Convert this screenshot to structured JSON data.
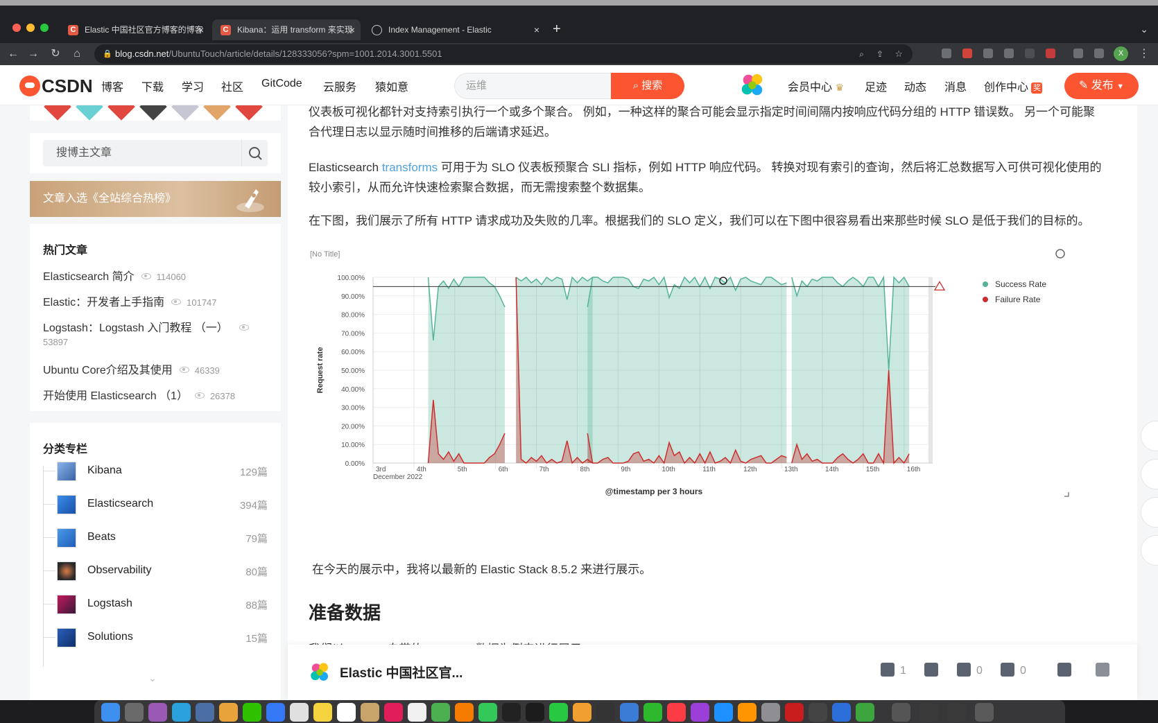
{
  "browser": {
    "tabs": [
      {
        "title": "Elastic 中国社区官方博客的博客",
        "active": false
      },
      {
        "title": "Kibana：运用 transform 来实现",
        "active": true
      },
      {
        "title": "Index Management - Elastic",
        "active": false
      }
    ],
    "url_host": "blog.csdn.net",
    "url_path": "/UbuntuTouch/article/details/128333056?spm=1001.2014.3001.5501",
    "profile_initial": "X"
  },
  "header": {
    "logo_text": "CSDN",
    "nav": [
      "博客",
      "下载",
      "学习",
      "社区",
      "GitCode",
      "云服务",
      "猿如意"
    ],
    "search_placeholder": "运维",
    "search_button": "搜索",
    "right_links": [
      "会员中心",
      "足迹",
      "动态",
      "消息",
      "创作中心"
    ],
    "creation_badge": "奖",
    "publish_button": "发布"
  },
  "sidebar": {
    "search_placeholder": "搜博主文章",
    "hot_banner": "文章入选《全站综合热榜》",
    "hot_title": "热门文章",
    "hot_articles": [
      {
        "title": "Elasticsearch 简介",
        "views": "114060"
      },
      {
        "title": "Elastic：开发者上手指南",
        "views": "101747"
      },
      {
        "title": "Logstash：Logstash 入门教程 （一）",
        "views": "53897"
      },
      {
        "title": "Ubuntu Core介绍及其使用",
        "views": "46339"
      },
      {
        "title": "开始使用 Elasticsearch （1）",
        "views": "26378"
      }
    ],
    "columns_title": "分类专栏",
    "columns": [
      {
        "name": "Kibana",
        "count": "129篇"
      },
      {
        "name": "Elasticsearch",
        "count": "394篇"
      },
      {
        "name": "Beats",
        "count": "79篇"
      },
      {
        "name": "Observability",
        "count": "80篇"
      },
      {
        "name": "Logstash",
        "count": "88篇"
      },
      {
        "name": "Solutions",
        "count": "15篇"
      }
    ]
  },
  "article": {
    "p1": "仪表板可视化都针对支持索引执行一个或多个聚合。 例如，一种这样的聚合可能会显示指定时间间隔内按响应代码分组的 HTTP 错误数。 另一个可能聚合代理日志以显示随时间推移的后端请求延迟。",
    "p2_before": "Elasticsearch ",
    "p2_link": "transforms",
    "p2_after": " 可用于为 SLO 仪表板预聚合 SLI 指标，例如 HTTP 响应代码。 转换对现有索引的查询，然后将汇总数据写入可供可视化使用的较小索引，从而允许快速检索聚合数据，而无需搜索整个数据集。",
    "p3": "在下图，我们展示了所有 HTTP 请求成功及失败的几率。根据我们的 SLO 定义，我们可以在下图中很容易看出来那些时候 SLO 是低于我们的目标的。",
    "p4": "在今天的展示中，我将以最新的 Elastic Stack 8.5.2 来进行展示。",
    "h2": "准备数据",
    "p5_partial": "我们以 Kibana 自带的 web logs 数据为例来进行展示"
  },
  "chart_data": {
    "type": "area",
    "title": "[No Title]",
    "xlabel": "@timestamp per 3 hours",
    "ylabel": "Request rate",
    "x_ticks": [
      "3rd",
      "4th",
      "5th",
      "6th",
      "7th",
      "8th",
      "9th",
      "10th",
      "11th",
      "12th",
      "13th",
      "14th",
      "15th",
      "16th"
    ],
    "x_sublabel": "December 2022",
    "y_ticks": [
      "100.00%",
      "90.00%",
      "80.00%",
      "70.00%",
      "60.00%",
      "50.00%",
      "40.00%",
      "30.00%",
      "20.00%",
      "10.00%",
      "0.00%"
    ],
    "ylim": [
      0,
      100
    ],
    "threshold": 95,
    "legend_position": "right",
    "colors": {
      "success": "#54b399",
      "failure": "#cc2e2e"
    },
    "series": [
      {
        "name": "Success Rate",
        "segments": [
          {
            "start": 1.35,
            "values": [
              100,
              66,
              95,
              98,
              94,
              99,
              95,
              100,
              100,
              100,
              100,
              100,
              97,
              95,
              90,
              84
            ]
          },
          {
            "start": 3.5,
            "values": [
              100,
              98,
              100,
              97,
              99,
              96,
              100,
              98,
              100,
              99,
              88,
              100,
              97,
              100,
              98,
              100
            ]
          },
          {
            "start": 5.25,
            "values": [
              84,
              100,
              100,
              98,
              97,
              100,
              100,
              100,
              99,
              95,
              94,
              99,
              98,
              100,
              96,
              100,
              89,
              96,
              94,
              100,
              97,
              100,
              95,
              100,
              94,
              100,
              99,
              97,
              100,
              93,
              99,
              100,
              98,
              97,
              96,
              100,
              100,
              98,
              96,
              97
            ]
          },
          {
            "start": 10.25,
            "values": [
              100,
              90,
              98,
              95,
              99,
              98,
              100,
              100,
              100,
              97,
              95,
              98,
              100,
              98,
              95,
              100,
              100,
              95,
              100,
              50,
              100,
              97,
              100,
              95
            ]
          }
        ]
      },
      {
        "name": "Failure Rate",
        "segments": [
          {
            "start": 1.35,
            "values": [
              0,
              34,
              5,
              2,
              6,
              1,
              5,
              0,
              0,
              0,
              0,
              0,
              3,
              5,
              10,
              16
            ]
          },
          {
            "start": 3.5,
            "values": [
              100,
              2,
              0,
              3,
              1,
              4,
              0,
              2,
              0,
              1,
              12,
              0,
              3,
              0,
              2,
              0
            ]
          },
          {
            "start": 5.25,
            "values": [
              16,
              0,
              0,
              2,
              3,
              0,
              0,
              0,
              1,
              5,
              6,
              1,
              2,
              0,
              4,
              0,
              11,
              4,
              6,
              0,
              3,
              0,
              5,
              0,
              6,
              0,
              1,
              3,
              0,
              7,
              1,
              0,
              2,
              3,
              4,
              0,
              0,
              2,
              4,
              3
            ]
          },
          {
            "start": 10.25,
            "values": [
              0,
              10,
              2,
              5,
              1,
              2,
              0,
              0,
              0,
              3,
              5,
              2,
              0,
              2,
              5,
              0,
              0,
              5,
              0,
              50,
              0,
              3,
              0,
              5
            ]
          }
        ]
      }
    ]
  },
  "bottom_bar": {
    "author": "Elastic 中国社区官...",
    "likes": "1",
    "favorites": "0",
    "comments": "0"
  }
}
